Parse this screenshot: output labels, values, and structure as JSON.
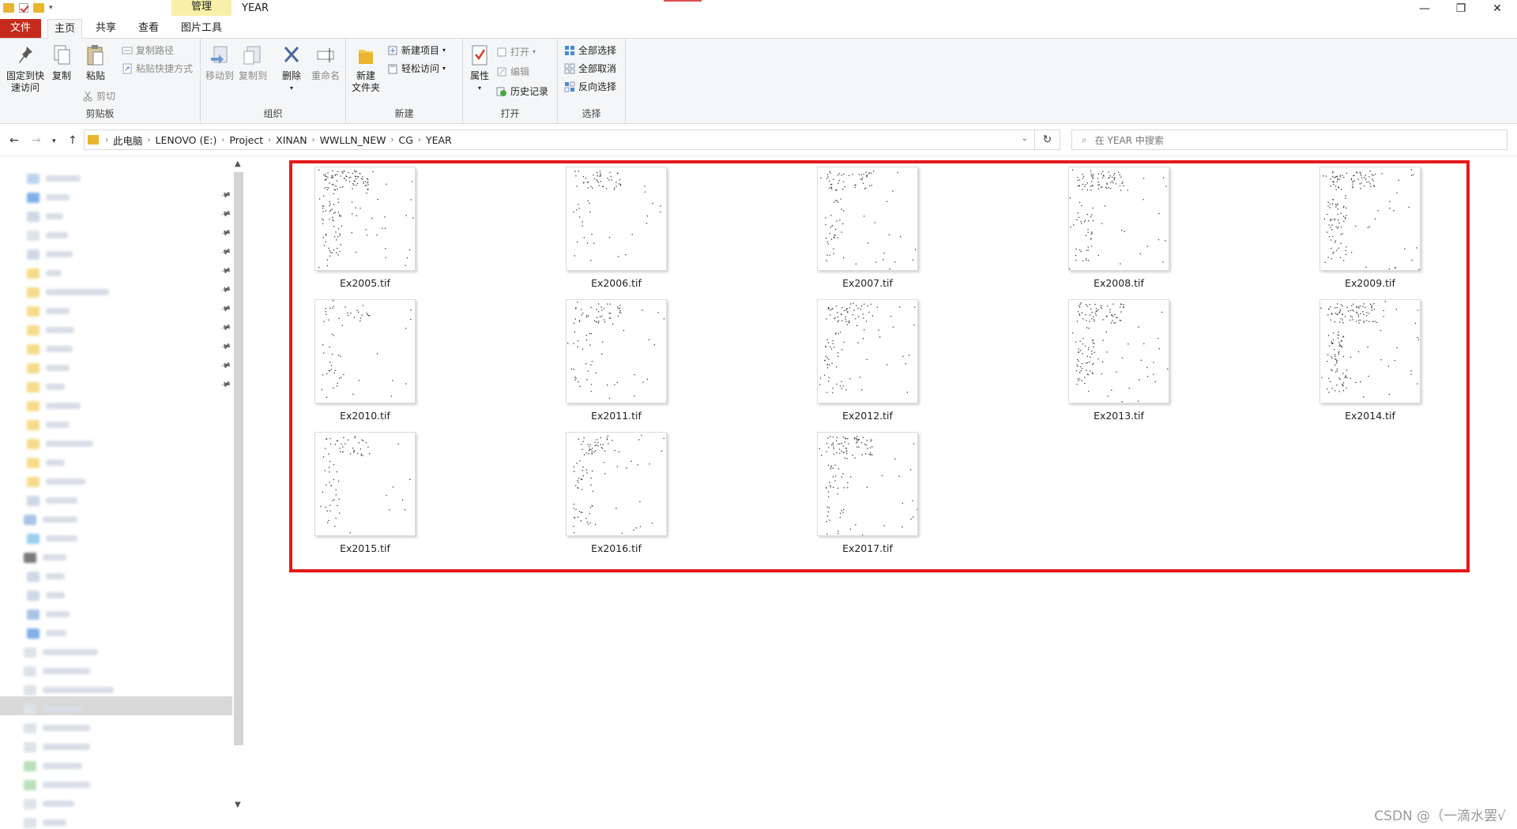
{
  "window": {
    "title": "YEAR",
    "context_tab": "管理",
    "controls": {
      "minimize": "—",
      "maximize": "❐",
      "close": "✕"
    },
    "quick_access_icons": [
      "folder-icon",
      "properties-check-icon",
      "new-folder-icon",
      "dropdown-icon"
    ]
  },
  "tabs": [
    {
      "label": "文件"
    },
    {
      "label": "主页"
    },
    {
      "label": "共享"
    },
    {
      "label": "查看"
    },
    {
      "label": "图片工具"
    }
  ],
  "ribbon": {
    "clipboard": {
      "label": "剪贴板",
      "pin_line1": "固定到快",
      "pin_line2": "速访问",
      "copy": "复制",
      "paste": "粘贴",
      "copy_path": "复制路径",
      "paste_shortcut": "粘贴快捷方式",
      "cut": "剪切"
    },
    "organize": {
      "label": "组织",
      "move_to": "移动到",
      "copy_to": "复制到",
      "delete": "删除",
      "rename": "重命名"
    },
    "new": {
      "label": "新建",
      "new_item": "新建项目",
      "easy_access": "轻松访问",
      "new_folder_line1": "新建",
      "new_folder_line2": "文件夹"
    },
    "open": {
      "label": "打开",
      "properties": "属性",
      "open": "打开",
      "edit": "编辑",
      "history": "历史记录"
    },
    "select": {
      "label": "选择",
      "select_all": "全部选择",
      "select_none": "全部取消",
      "invert": "反向选择"
    }
  },
  "address": {
    "breadcrumbs": [
      "此电脑",
      "LENOVO (E:)",
      "Project",
      "XINAN",
      "WWLLN_NEW",
      "CG",
      "YEAR"
    ],
    "search_placeholder": "在 YEAR 中搜索"
  },
  "files": [
    {
      "name": "Ex2005.tif"
    },
    {
      "name": "Ex2006.tif"
    },
    {
      "name": "Ex2007.tif"
    },
    {
      "name": "Ex2008.tif"
    },
    {
      "name": "Ex2009.tif"
    },
    {
      "name": "Ex2010.tif"
    },
    {
      "name": "Ex2011.tif"
    },
    {
      "name": "Ex2012.tif"
    },
    {
      "name": "Ex2013.tif"
    },
    {
      "name": "Ex2014.tif"
    },
    {
      "name": "Ex2015.tif"
    },
    {
      "name": "Ex2016.tif"
    },
    {
      "name": "Ex2017.tif"
    }
  ],
  "watermark": "CSDN @（一滴水罢√",
  "colors": {
    "file_tab": "#c42b1c",
    "context_tab": "#f8f0a8",
    "highlight_border": "#e61818",
    "accent_blue": "#1a73c8"
  }
}
